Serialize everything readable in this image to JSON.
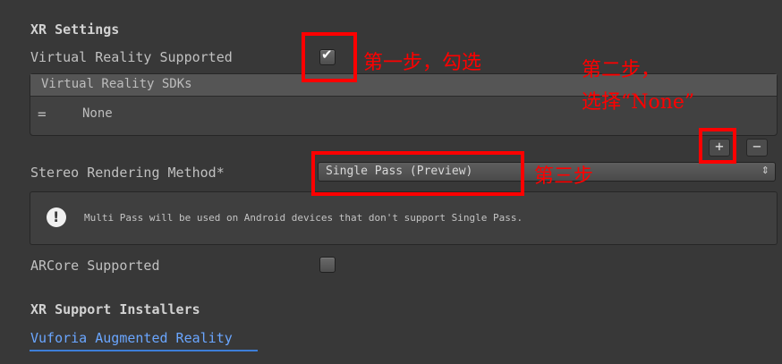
{
  "xr_settings": {
    "title": "XR Settings",
    "virtual_reality_supported": {
      "label": "Virtual Reality Supported",
      "checked": true,
      "check_glyph": "✔"
    },
    "sdks": {
      "header": "Virtual Reality SDKs",
      "items": [
        {
          "handle": "=",
          "name": "None"
        }
      ],
      "add_button": "+",
      "remove_button": "−"
    },
    "stereo_rendering": {
      "label": "Stereo Rendering Method*",
      "value": "Single Pass (Preview)",
      "arrow": "⇕"
    },
    "help": {
      "icon": "!",
      "text": "Multi Pass will be used on Android devices that don't support Single Pass."
    },
    "arcore": {
      "label": "ARCore Supported",
      "checked": false
    }
  },
  "installers": {
    "title": "XR Support Installers",
    "link": "Vuforia Augmented Reality"
  },
  "annotations": {
    "step1": "第一步，勾选",
    "step2_line1": "第二步，",
    "step2_line2": "选择“None”",
    "step3": "第三步",
    "color": "#ff0000"
  }
}
